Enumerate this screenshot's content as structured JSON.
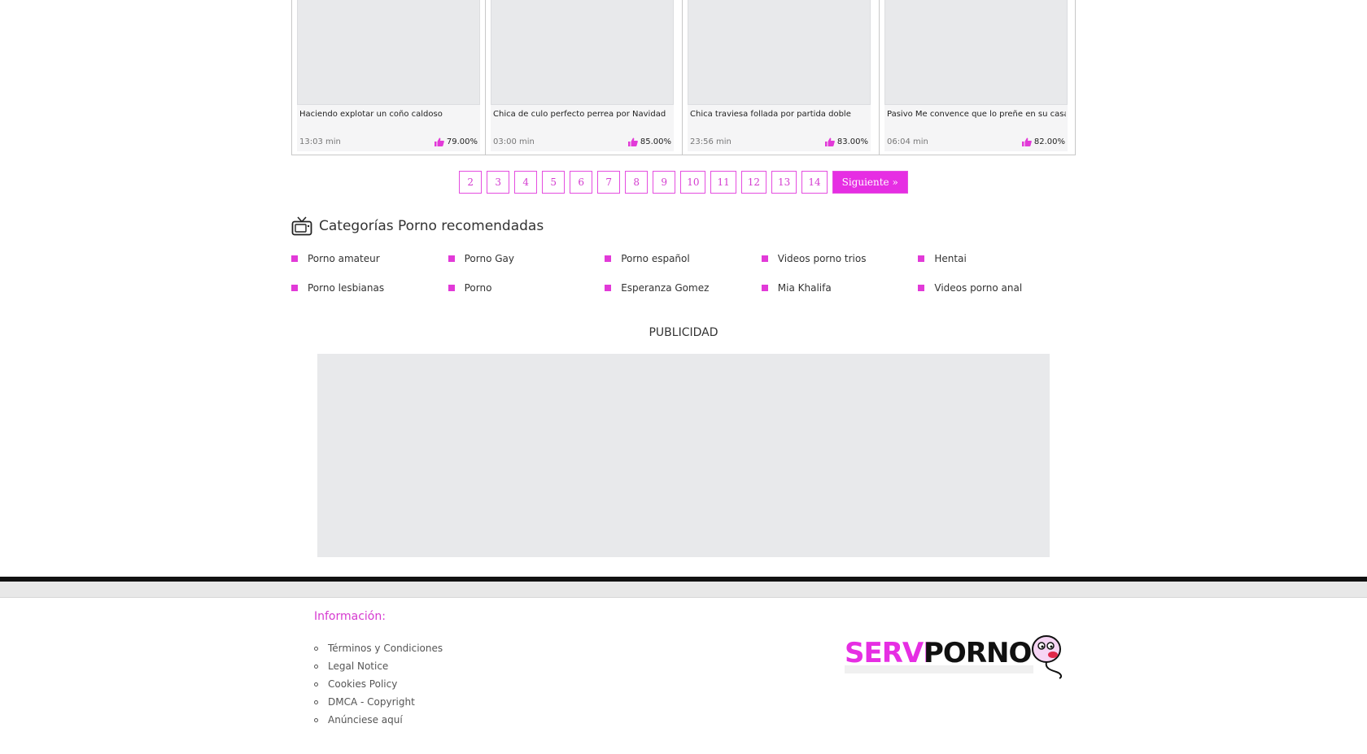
{
  "videos": [
    {
      "title": "Haciendo explotar un coño caldoso",
      "duration": "13:03 min",
      "rating": "79.00%"
    },
    {
      "title": "Chica de culo perfecto perrea por Navidad",
      "duration": "03:00 min",
      "rating": "85.00%"
    },
    {
      "title": "Chica traviesa follada por partida doble",
      "duration": "23:56 min",
      "rating": "83.00%"
    },
    {
      "title": "Pasivo Me convence que lo preñe en su casa",
      "duration": "06:04 min",
      "rating": "82.00%"
    }
  ],
  "pagination": {
    "pages": [
      "2",
      "3",
      "4",
      "5",
      "6",
      "7",
      "8",
      "9",
      "10",
      "11",
      "12",
      "13",
      "14"
    ],
    "next": "Siguiente »"
  },
  "categories": {
    "title": "Categorías Porno recomendadas",
    "items": [
      "Porno amateur",
      "Porno Gay",
      "Porno español",
      "Videos porno trios",
      "Hentai",
      "Porno lesbianas",
      "Porno",
      "Esperanza Gomez",
      "Mia Khalifa",
      "Videos porno anal"
    ]
  },
  "ad": {
    "label": "PUBLICIDAD"
  },
  "footer": {
    "info_title": "Información:",
    "links": [
      "Términos y Condiciones",
      "Legal Notice",
      "Cookies Policy",
      "DMCA - Copyright",
      "Anúnciese aquí"
    ],
    "logo": {
      "part1": "SERVI",
      "part2": "PORNO"
    }
  },
  "colors": {
    "accent": "#e62ee3",
    "bullet": "#e23ad8"
  }
}
